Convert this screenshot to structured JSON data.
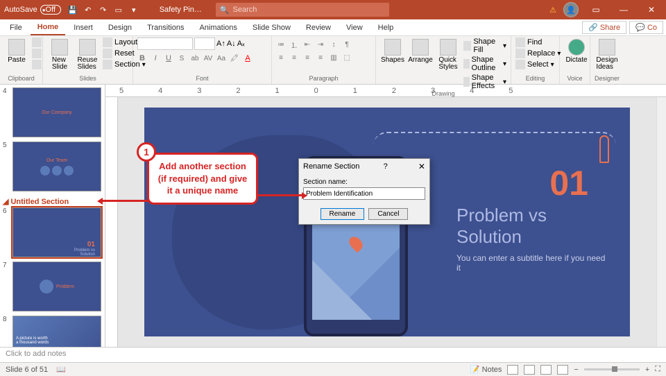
{
  "titlebar": {
    "autosave_label": "AutoSave",
    "autosave_state": "Off",
    "doc_title": "Safety Pin…",
    "search_placeholder": "Search"
  },
  "menu": {
    "tabs": [
      "File",
      "Home",
      "Insert",
      "Design",
      "Transitions",
      "Animations",
      "Slide Show",
      "Review",
      "View",
      "Help"
    ],
    "active": 1,
    "share": "Share",
    "comments": "Co"
  },
  "ribbon": {
    "clipboard": {
      "label": "Clipboard",
      "paste": "Paste"
    },
    "slides": {
      "label": "Slides",
      "new": "New\nSlide",
      "reuse": "Reuse\nSlides",
      "layout": "Layout",
      "reset": "Reset",
      "section": "Section"
    },
    "font": {
      "label": "Font"
    },
    "paragraph": {
      "label": "Paragraph"
    },
    "drawing": {
      "label": "Drawing",
      "shapes": "Shapes",
      "arrange": "Arrange",
      "quick": "Quick\nStyles",
      "fill": "Shape Fill",
      "outline": "Shape Outline",
      "effects": "Shape Effects"
    },
    "editing": {
      "label": "Editing",
      "find": "Find",
      "replace": "Replace",
      "select": "Select"
    },
    "voice": {
      "label": "Voice",
      "dictate": "Dictate"
    },
    "designer": {
      "label": "Designer",
      "design": "Design\nIdeas"
    }
  },
  "thumbs": {
    "section_name": "Untitled Section",
    "nums": [
      "4",
      "5",
      "6",
      "7",
      "8"
    ],
    "t4_title": "Our Company",
    "t5_title": "Our Team",
    "t6_num": "01",
    "t6_title": "Problem vs\nSolution",
    "t7_title": "Problem",
    "t8_title": "A picture is worth a thousand words"
  },
  "slide": {
    "num": "01",
    "title": "Problem vs Solution",
    "subtitle": "You can enter a subtitle here if you need it"
  },
  "dialog": {
    "title": "Rename Section",
    "label": "Section name:",
    "value": "Problem Identification",
    "rename": "Rename",
    "cancel": "Cancel"
  },
  "callout": {
    "badge": "1",
    "text": "Add another section (if required) and give it a unique name"
  },
  "notes": "Click to add notes",
  "status": {
    "slide": "Slide 6 of 51",
    "notes_btn": "Notes",
    "zoom": "– — +"
  }
}
